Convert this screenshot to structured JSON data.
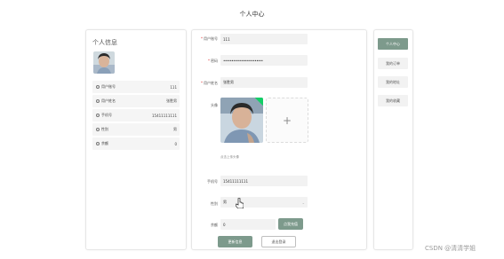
{
  "page": {
    "title": "个人中心"
  },
  "info_panel": {
    "title": "个人信息",
    "rows": [
      {
        "label": "用户账号",
        "value": "111"
      },
      {
        "label": "用户姓名",
        "value": "张胜男"
      },
      {
        "label": "手机号",
        "value": "15411111111"
      },
      {
        "label": "性别",
        "value": "男"
      },
      {
        "label": "余额",
        "value": "0"
      }
    ]
  },
  "form": {
    "account": {
      "label": "用户账号",
      "value": "111"
    },
    "password": {
      "label": "密码",
      "value": "••••••••••••••••••••••••"
    },
    "name": {
      "label": "用户姓名",
      "value": "张胜男"
    },
    "avatar": {
      "label": "头像",
      "hint": "点击上传头像"
    },
    "phone": {
      "label": "手机号",
      "value": "15411111111"
    },
    "gender": {
      "label": "性别",
      "value": "男"
    },
    "balance": {
      "label": "余额",
      "value": "0",
      "recharge_label": "点我充值"
    },
    "update_label": "更新信息",
    "logout_label": "退出登录"
  },
  "menu": {
    "items": [
      {
        "label": "个人中心",
        "active": true
      },
      {
        "label": "我的订单",
        "active": false
      },
      {
        "label": "我的地址",
        "active": false
      },
      {
        "label": "我的收藏",
        "active": false
      }
    ]
  },
  "watermark": "CSDN @清清学姐",
  "colors": {
    "accent": "#7d9a8c",
    "badge": "#13ce66",
    "required": "#dd3333"
  }
}
